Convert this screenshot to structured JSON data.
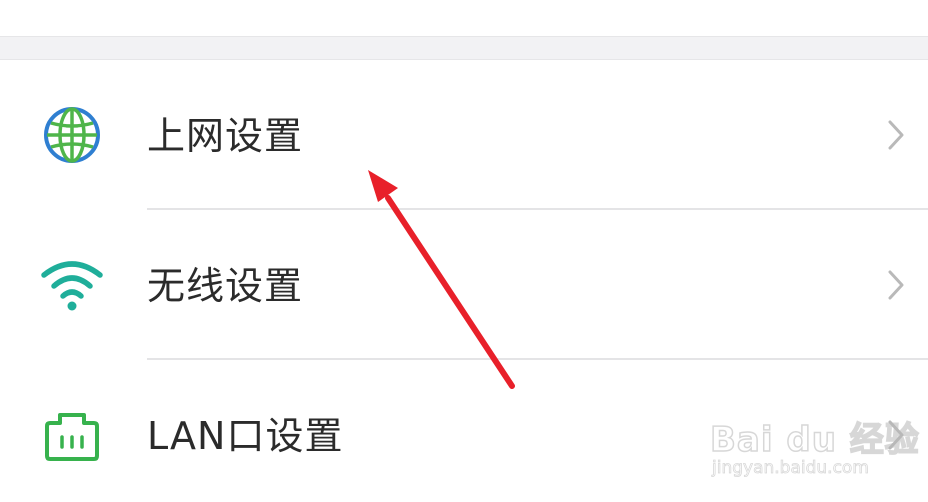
{
  "menu": {
    "items": [
      {
        "label": "上网设置",
        "icon": "globe-icon"
      },
      {
        "label": "无线设置",
        "icon": "wifi-icon"
      },
      {
        "label": "LAN口设置",
        "icon": "lan-port-icon"
      }
    ]
  },
  "watermark": {
    "logo_text": "Bai du 经验",
    "url_text": "jingyan.baidu.com"
  },
  "colors": {
    "globe_blue": "#2f7fd1",
    "globe_green": "#4fb54a",
    "wifi_teal": "#1fae9a",
    "lan_green": "#37b24d",
    "arrow_red": "#e8202a",
    "chevron_gray": "#b9b9b9"
  }
}
